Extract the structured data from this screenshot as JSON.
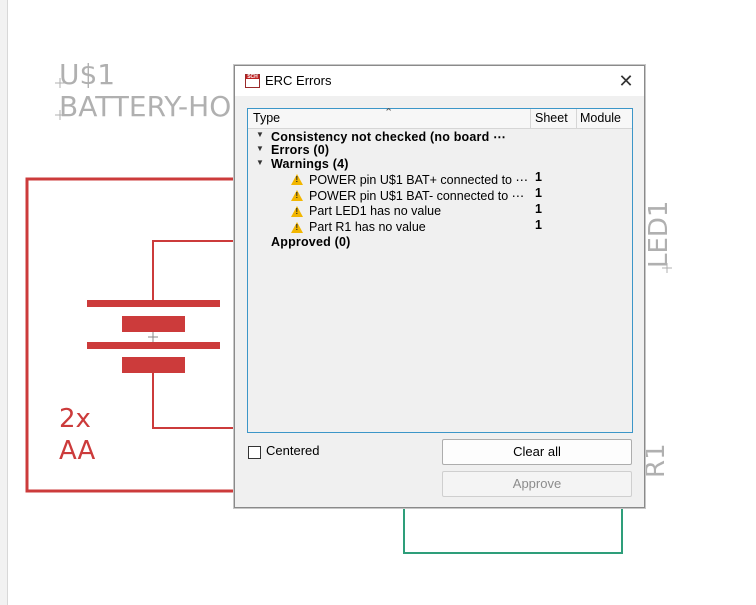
{
  "schematic": {
    "part_name": "U$1",
    "part_value": "BATTERY-HO",
    "battery_label_1": "2x",
    "battery_label_2": "AA",
    "led_label": "LED1",
    "resistor_label": "R1"
  },
  "dialog": {
    "title": "ERC Errors",
    "app_icon_text": "SCH",
    "close_glyph": "✕",
    "columns": {
      "type": "Type",
      "sheet": "Sheet",
      "module": "Module"
    },
    "tree": {
      "consistency": "Consistency not checked (no board ⋯",
      "errors": "Errors (0)",
      "warnings": "Warnings (4)",
      "warning_items": [
        {
          "text": "POWER pin U$1 BAT+ connected to ⋯",
          "sheet": "1"
        },
        {
          "text": "POWER pin U$1 BAT- connected to ⋯",
          "sheet": "1"
        },
        {
          "text": "Part LED1 has no value",
          "sheet": "1"
        },
        {
          "text": "Part R1 has no value",
          "sheet": "1"
        }
      ],
      "approved": "Approved (0)"
    },
    "centered_label": "Centered",
    "centered_checked": false,
    "clear_all_label": "Clear all",
    "approve_label": "Approve"
  },
  "colors": {
    "accent_border": "#3c96c8",
    "warning": "#f2b600",
    "wire_red": "#cc3b3b",
    "wire_green": "#2e9e7a",
    "label_gray": "#b0b0b0"
  }
}
